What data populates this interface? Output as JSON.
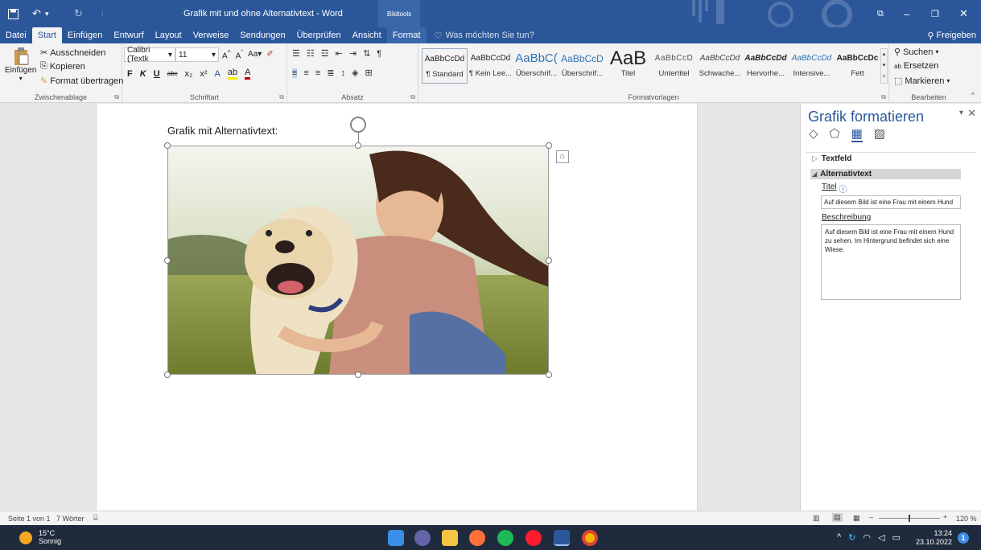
{
  "title_bar": {
    "doc_title": "Grafik mit und ohne Alternativtext - Word",
    "context_tab_group": "Bildtools"
  },
  "tabs": [
    "Datei",
    "Start",
    "Einfügen",
    "Entwurf",
    "Layout",
    "Verweise",
    "Sendungen",
    "Überprüfen",
    "Ansicht",
    "Format"
  ],
  "active_tab": "Start",
  "tell_me": "Was möchten Sie tun?",
  "share": "Freigeben",
  "clipboard": {
    "paste": "Einfügen",
    "cut": "Ausschneiden",
    "copy": "Kopieren",
    "format_painter": "Format übertragen",
    "label": "Zwischenablage"
  },
  "font": {
    "name": "Calibri (Textk",
    "size": "11",
    "label": "Schriftart",
    "bold": "F",
    "italic": "K",
    "underline": "U"
  },
  "paragraph": {
    "label": "Absatz"
  },
  "styles": {
    "label": "Formatvorlagen",
    "items": [
      {
        "sample": "AaBbCcDd",
        "name": "¶ Standard"
      },
      {
        "sample": "AaBbCcDd",
        "name": "¶ Kein Lee..."
      },
      {
        "sample": "AaBbC(",
        "name": "Überschrif..."
      },
      {
        "sample": "AaBbCcD",
        "name": "Überschrif..."
      },
      {
        "sample": "AaB",
        "name": "Titel"
      },
      {
        "sample": "AaBbCcD",
        "name": "Untertitel"
      },
      {
        "sample": "AaBbCcDd",
        "name": "Schwache..."
      },
      {
        "sample": "AaBbCcDd",
        "name": "Hervorhe..."
      },
      {
        "sample": "AaBbCcDd",
        "name": "Intensive..."
      },
      {
        "sample": "AaBbCcDc",
        "name": "Fett"
      }
    ]
  },
  "editing": {
    "find": "Suchen",
    "replace": "Ersetzen",
    "select": "Markieren",
    "label": "Bearbeiten"
  },
  "document": {
    "heading": "Grafik mit Alternativtext:"
  },
  "format_pane": {
    "title": "Grafik formatieren",
    "section_textbox": "Textfeld",
    "section_alt": "Alternativtext",
    "title_label": "Titel",
    "title_value": "Auf diesem Bild ist eine Frau mit einem Hund",
    "desc_label": "Beschreibung",
    "desc_value": "Auf diesem Bild ist eine Frau mit einem Hund zu sehen. Im Hintergrund befindet sich eine Wiese."
  },
  "status": {
    "page": "Seite 1 von 1",
    "words": "7 Wörter",
    "zoom": "120 %"
  },
  "taskbar": {
    "temp": "15°C",
    "weather": "Sonnig",
    "time": "13:24",
    "date": "23.10.2022",
    "notif_count": "1"
  },
  "colors": {
    "word_blue": "#2b579a",
    "ribbon": "#f3f3f3",
    "taskbar": "#1f2b3d"
  }
}
